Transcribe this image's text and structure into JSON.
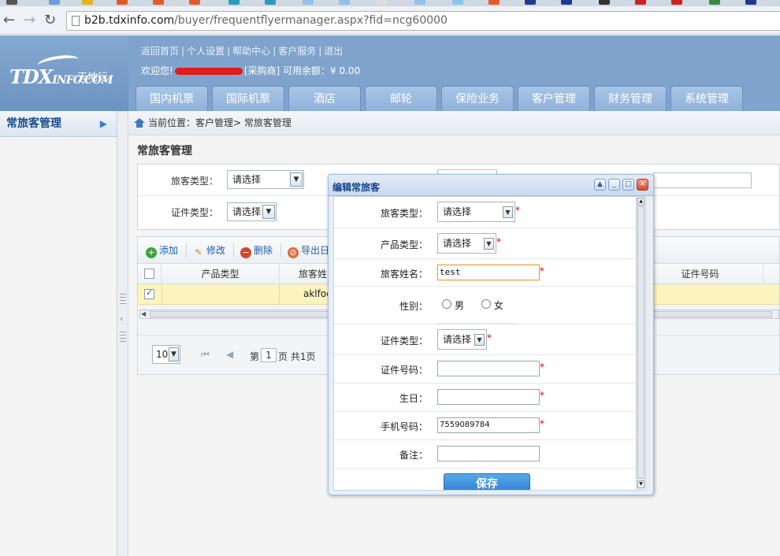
{
  "browser": {
    "url_host": "b2b.tdxinfo.com",
    "url_path": "/buyer/frequentflyermanager.aspx?fid=ncg60000"
  },
  "header": {
    "logo_text": "TDX",
    "logo_suffix": "INFO.COM",
    "logo_cn": "天地行",
    "top_links": [
      "返回首页",
      "个人设置",
      "帮助中心",
      "客户服务",
      "退出"
    ],
    "welcome_prefix": "欢迎您!",
    "welcome_role": "[采购商]",
    "balance_label": "可用余额：",
    "balance_value": "¥ 0.00",
    "nav_tabs": [
      "国内机票",
      "国际机票",
      "酒店",
      "邮轮",
      "保险业务",
      "客户管理",
      "财务管理",
      "系统管理"
    ]
  },
  "sidebar": {
    "title": "常旅客管理"
  },
  "breadcrumb": {
    "text": "当前位置：客户管理> 常旅客管理"
  },
  "page": {
    "title": "常旅客管理",
    "search": {
      "traveler_type_label": "旅客类型：",
      "traveler_type_value": "请选择",
      "id_type_label": "证件类型：",
      "id_type_value": "请选择"
    },
    "toolbar": {
      "add": "添加",
      "edit": "修改",
      "delete": "删除",
      "export": "导出日"
    },
    "grid": {
      "columns": [
        "产品类型",
        "旅客姓",
        "证件号码"
      ],
      "rows": [
        {
          "product_type": "",
          "traveler_name": "aklfoe"
        }
      ]
    },
    "pager": {
      "page_size": "10",
      "page_prefix": "第",
      "page_number": "1",
      "page_suffix": "页 共1页"
    }
  },
  "dialog": {
    "title": "编辑常旅客",
    "fields": {
      "traveler_type": {
        "label": "旅客类型：",
        "value": "请选择"
      },
      "product_type": {
        "label": "产品类型：",
        "value": "请选择"
      },
      "traveler_name": {
        "label": "旅客姓名：",
        "value": "test"
      },
      "gender": {
        "label": "性别：",
        "options": [
          "男",
          "女"
        ]
      },
      "id_type": {
        "label": "证件类型：",
        "value": "请选择"
      },
      "id_number": {
        "label": "证件号码：",
        "value": ""
      },
      "birthday": {
        "label": "生日：",
        "value": ""
      },
      "mobile": {
        "label": "手机号码：",
        "value": "7559089784"
      },
      "remark": {
        "label": "备注：",
        "value": ""
      }
    },
    "required_mark": "*",
    "save_label": "保存"
  },
  "colors": {
    "header_blue": "#7fa3cc",
    "dialog_title": "#15428b",
    "selected_row": "#fbf4bf",
    "save_button": "#2c80d3",
    "required": "#dd0000"
  }
}
